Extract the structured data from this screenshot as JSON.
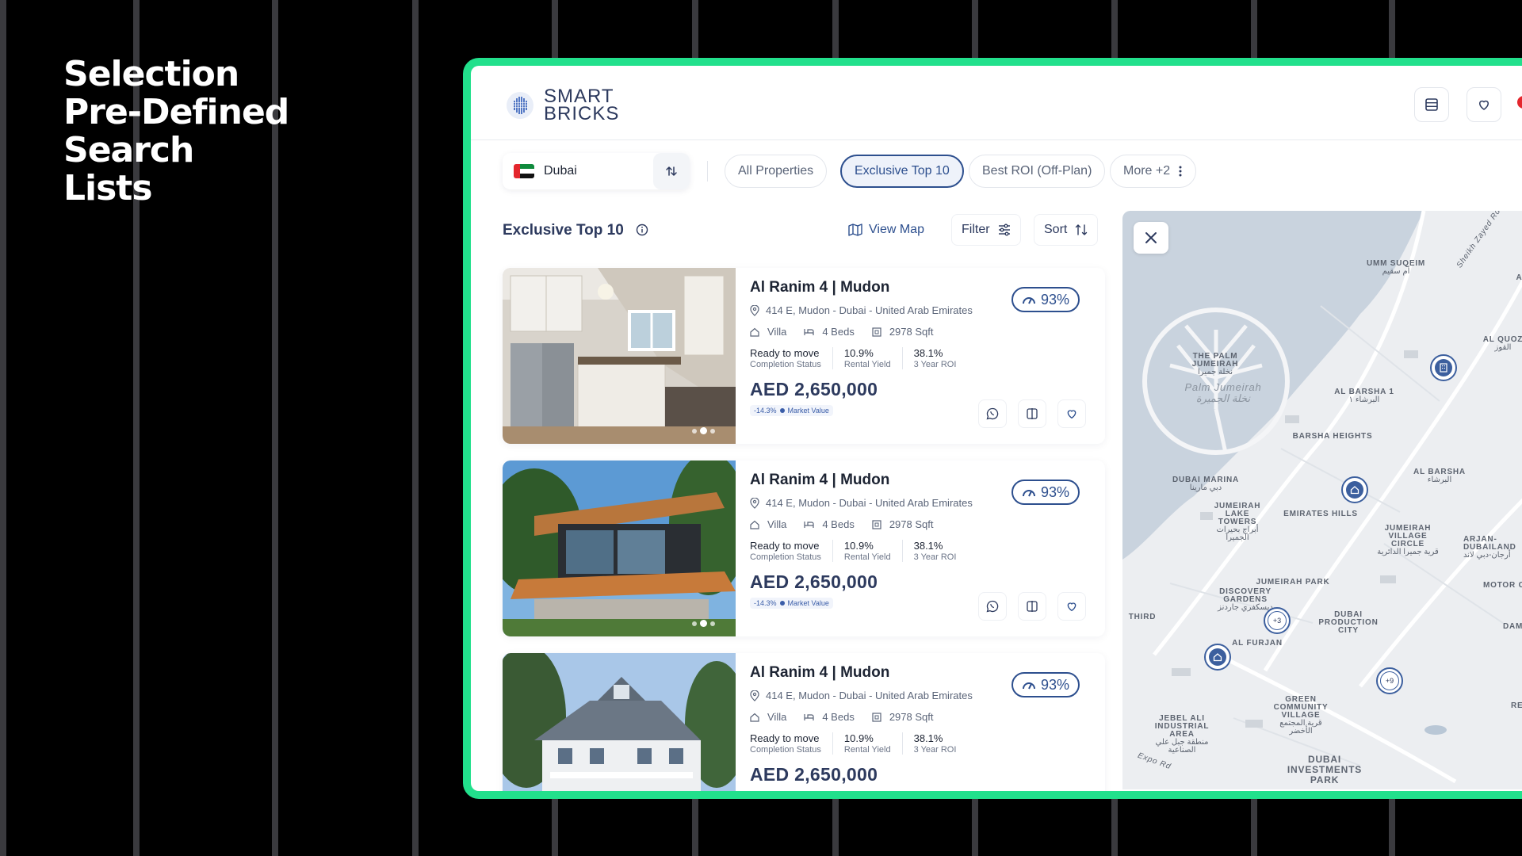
{
  "headline": {
    "line1": "Selection",
    "line2": "Pre-Defined Search",
    "line3": "Lists"
  },
  "app": {
    "logo_line1": "SMART",
    "logo_line2": "BRICKS",
    "brand_color": "#2d3a5e",
    "accent_color": "#22e08c"
  },
  "filters": {
    "city": "Dubai",
    "chips": [
      {
        "label": "All Properties",
        "active": false
      },
      {
        "label": "Exclusive Top 10",
        "active": true
      },
      {
        "label": "Best ROI (Off-Plan)",
        "active": false
      },
      {
        "label": "More +2",
        "active": false
      }
    ]
  },
  "list": {
    "title": "Exclusive Top 10",
    "view_map": "View Map",
    "filter": "Filter",
    "sort": "Sort",
    "properties": [
      {
        "title": "Al Ranim 4 | Mudon",
        "address": "414 E, Mudon - Dubai - United Arab Emirates",
        "type": "Villa",
        "beds": "4 Beds",
        "area": "2978 Sqft",
        "status_value": "Ready to move",
        "status_label": "Completion Status",
        "yield_value": "10.9%",
        "yield_label": "Rental Yield",
        "roi_value": "38.1%",
        "roi_label": "3 Year ROI",
        "price": "AED 2,650,000",
        "market_delta": "-14.3%",
        "market_label": "Market Value",
        "score": "93%"
      },
      {
        "title": "Al Ranim 4 | Mudon",
        "address": "414 E, Mudon - Dubai - United Arab Emirates",
        "type": "Villa",
        "beds": "4 Beds",
        "area": "2978 Sqft",
        "status_value": "Ready to move",
        "status_label": "Completion Status",
        "yield_value": "10.9%",
        "yield_label": "Rental Yield",
        "roi_value": "38.1%",
        "roi_label": "3 Year ROI",
        "price": "AED 2,650,000",
        "market_delta": "-14.3%",
        "market_label": "Market Value",
        "score": "93%"
      },
      {
        "title": "Al Ranim 4 | Mudon",
        "address": "414 E, Mudon - Dubai - United Arab Emirates",
        "type": "Villa",
        "beds": "4 Beds",
        "area": "2978 Sqft",
        "status_value": "Ready to move",
        "status_label": "Completion Status",
        "yield_value": "10.9%",
        "yield_label": "Rental Yield",
        "roi_value": "38.1%",
        "roi_label": "3 Year ROI",
        "price": "AED 2,650,000",
        "score": "93%"
      }
    ]
  },
  "map": {
    "labels": {
      "umm_suqeim": "UMM SUQEIM",
      "umm_suqeim_ar": "أم سقيم",
      "al_quoz": "AL QUOZ",
      "al_quoz_ar": "القوز",
      "palm": "THE PALM JUMEIRAH",
      "palm_ar": "نخلة جميرا",
      "palm_water": "Palm Jumeirah",
      "palm_water_ar": "نخلة الجميرة",
      "al_barsha_1": "AL BARSHA 1",
      "al_barsha_1_ar": "البرشاء ١",
      "barsha_heights": "BARSHA HEIGHTS",
      "al_barsha": "AL BARSHA",
      "al_barsha_ar": "البرشاء",
      "dubai_marina": "DUBAI MARINA",
      "dubai_marina_ar": "دبي مارينا",
      "jlt": "JUMEIRAH LAKE TOWERS",
      "jlt_ar": "أبراج بحيرات الجميرا",
      "emirates_hills": "EMIRATES HILLS",
      "jvc": "JUMEIRAH VILLAGE CIRCLE",
      "jvc_ar": "قرية جميرا الدائرية",
      "arjan": "ARJAN-DUBAILAND",
      "arjan_ar": "أرجان-دبي لاند",
      "jumeirah_park": "JUMEIRAH PARK",
      "discovery": "DISCOVERY GARDENS",
      "discovery_ar": "ديسكفري جاردنز",
      "motor_city": "MOTOR CITY",
      "third": "THIRD",
      "dubai_production": "DUBAI PRODUCTION CITY",
      "dama": "DAMA",
      "al_furjan": "AL FURJAN",
      "green_community": "GREEN COMMUNITY VILLAGE",
      "green_community_ar": "قرية المجتمع الأخضر",
      "jebel_ali": "JEBEL ALI INDUSTRIAL AREA",
      "jebel_ali_ar": "منطقة جبل علي الصناعية",
      "rem": "REM",
      "dip": "DUBAI INVESTMENTS PARK",
      "expo_rd": "Expo Rd",
      "sheikh_zayed": "Sheikh Zayed Rd",
      "al_q": "AL Q"
    },
    "clusters": [
      "+3",
      "+9"
    ]
  }
}
